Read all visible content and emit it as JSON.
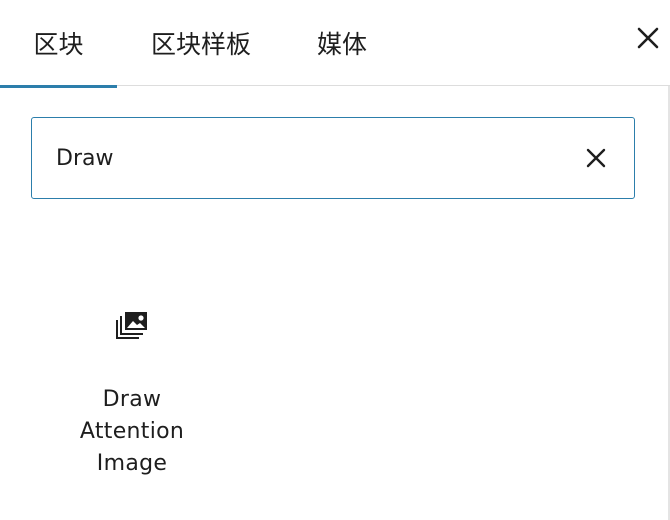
{
  "tabs": [
    {
      "label": "区块",
      "active": true
    },
    {
      "label": "区块样板",
      "active": false
    },
    {
      "label": "媒体",
      "active": false
    }
  ],
  "header": {
    "close_icon": "close-icon"
  },
  "search": {
    "value": "Draw",
    "clear_icon": "close-icon"
  },
  "results": [
    {
      "icon": "gallery-icon",
      "label": "Draw Attention Image"
    }
  ],
  "colors": {
    "accent": "#2c7eab",
    "text": "#1e1e1e",
    "divider": "#dddddd"
  }
}
